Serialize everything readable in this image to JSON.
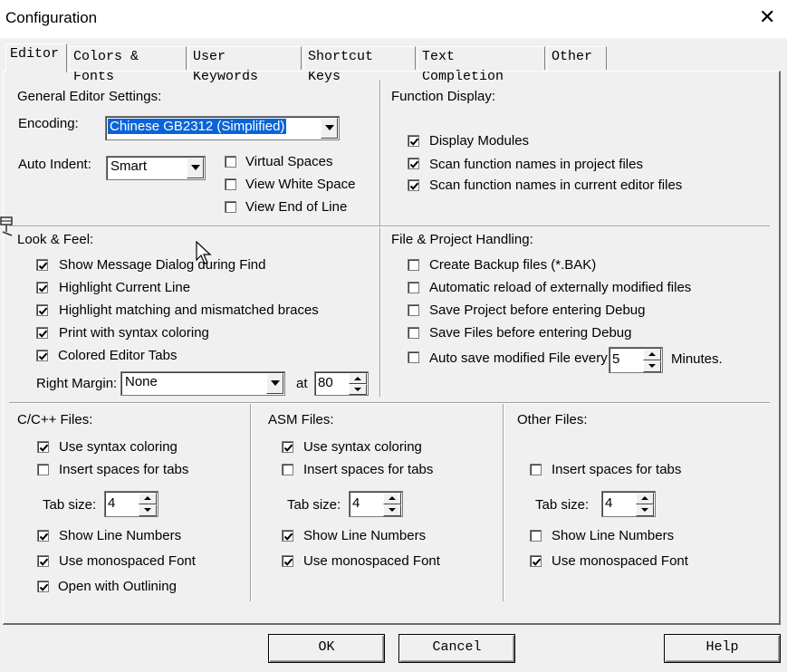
{
  "window": {
    "title": "Configuration",
    "close_glyph": "✕"
  },
  "tabs": [
    {
      "label": "Editor",
      "active": true
    },
    {
      "label": "Colors & Fonts",
      "active": false
    },
    {
      "label": "User Keywords",
      "active": false
    },
    {
      "label": "Shortcut Keys",
      "active": false
    },
    {
      "label": "Text Completion",
      "active": false
    },
    {
      "label": "Other",
      "active": false
    }
  ],
  "general": {
    "heading": "General Editor Settings:",
    "encoding_label": "Encoding:",
    "encoding_value": "Chinese GB2312 (Simplified)",
    "auto_indent_label": "Auto Indent:",
    "auto_indent_value": "Smart",
    "virtual_spaces": {
      "label": "Virtual Spaces",
      "checked": false
    },
    "view_white_space": {
      "label": "View White Space",
      "checked": false
    },
    "view_end_of_line": {
      "label": "View End of Line",
      "checked": false
    }
  },
  "function_display": {
    "heading": "Function Display:",
    "items": [
      {
        "label": "Display Modules",
        "checked": true
      },
      {
        "label": "Scan function names in project files",
        "checked": true
      },
      {
        "label": "Scan function names in current editor files",
        "checked": true
      }
    ]
  },
  "look_feel": {
    "heading": "Look & Feel:",
    "items": [
      {
        "label": "Show Message Dialog during Find",
        "checked": true
      },
      {
        "label": "Highlight Current Line",
        "checked": true
      },
      {
        "label": "Highlight matching and mismatched braces",
        "checked": true
      },
      {
        "label": "Print with syntax coloring",
        "checked": true
      },
      {
        "label": "Colored Editor Tabs",
        "checked": true
      }
    ],
    "right_margin_label": "Right Margin:",
    "right_margin_value": "None",
    "at_label": "at",
    "at_value": "80"
  },
  "file_project": {
    "heading": "File & Project Handling:",
    "items": [
      {
        "label": "Create Backup files (*.BAK)",
        "checked": false
      },
      {
        "label": "Automatic reload of externally modified files",
        "checked": false
      },
      {
        "label": "Save Project before entering Debug",
        "checked": false
      },
      {
        "label": "Save Files before entering Debug",
        "checked": false
      }
    ],
    "auto_save": {
      "label": "Auto save modified File every",
      "checked": false,
      "value": "5",
      "unit": "Minutes."
    }
  },
  "c_files": {
    "heading": "C/C++ Files:",
    "use_syntax": {
      "label": "Use syntax coloring",
      "checked": true
    },
    "insert_spaces": {
      "label": "Insert spaces for tabs",
      "checked": false
    },
    "tab_size_label": "Tab size:",
    "tab_size_value": "4",
    "show_line_numbers": {
      "label": "Show Line Numbers",
      "checked": true
    },
    "monospaced": {
      "label": "Use monospaced Font",
      "checked": true
    },
    "outlining": {
      "label": "Open with Outlining",
      "checked": true
    }
  },
  "asm_files": {
    "heading": "ASM Files:",
    "use_syntax": {
      "label": "Use syntax coloring",
      "checked": true
    },
    "insert_spaces": {
      "label": "Insert spaces for tabs",
      "checked": false
    },
    "tab_size_label": "Tab size:",
    "tab_size_value": "4",
    "show_line_numbers": {
      "label": "Show Line Numbers",
      "checked": true
    },
    "monospaced": {
      "label": "Use monospaced Font",
      "checked": true
    }
  },
  "other_files": {
    "heading": "Other Files:",
    "insert_spaces": {
      "label": "Insert spaces for tabs",
      "checked": false
    },
    "tab_size_label": "Tab size:",
    "tab_size_value": "4",
    "show_line_numbers": {
      "label": "Show Line Numbers",
      "checked": false
    },
    "monospaced": {
      "label": "Use monospaced Font",
      "checked": true
    }
  },
  "buttons": {
    "ok": "OK",
    "cancel": "Cancel",
    "help": "Help"
  },
  "icons": {
    "checkmark": "check-icon",
    "dropdown": "chevron-down-icon",
    "spin_up": "spin-up-icon",
    "spin_down": "spin-down-icon"
  }
}
